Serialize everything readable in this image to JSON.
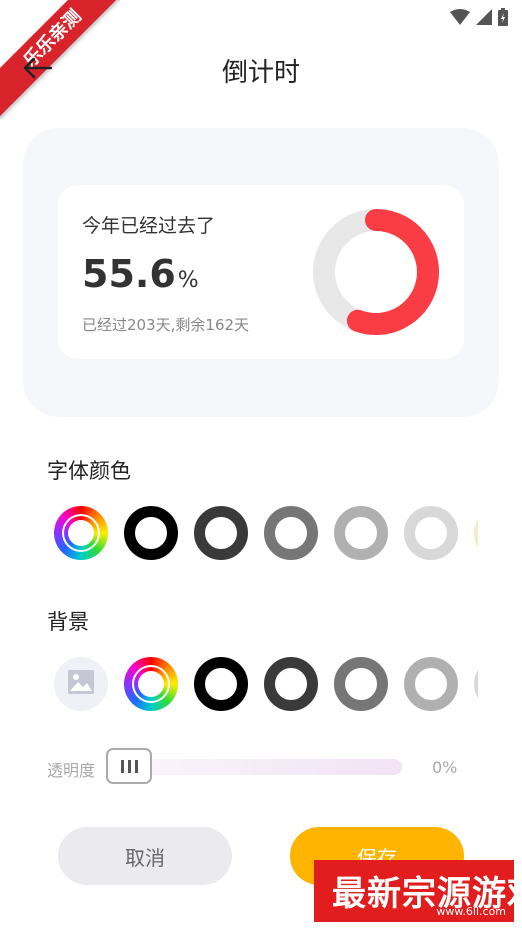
{
  "watermark_corner": "乐乐亲测",
  "header": {
    "title": "倒计时"
  },
  "widget": {
    "heading": "今年已经过去了",
    "percent_value": "55.6",
    "percent_unit": "%",
    "subtitle": "已经过203天,剩余162天",
    "progress_fraction": 0.556,
    "progress_color": "#fa3d45",
    "track_color": "#e8e8e8"
  },
  "font_color": {
    "label": "字体颜色",
    "swatches": [
      {
        "type": "rainbow",
        "icon": "color-wheel-icon"
      },
      {
        "type": "ring",
        "color": "#000000"
      },
      {
        "type": "ring",
        "color": "#3a3a3a"
      },
      {
        "type": "ring",
        "color": "#767676"
      },
      {
        "type": "ring",
        "color": "#b0b0b0"
      },
      {
        "type": "ring",
        "color": "#d8d8d8"
      },
      {
        "type": "ring",
        "color": "#f5ecc8"
      }
    ]
  },
  "background": {
    "label": "背景",
    "swatches": [
      {
        "type": "image",
        "icon": "image-icon"
      },
      {
        "type": "rainbow",
        "icon": "color-wheel-icon"
      },
      {
        "type": "ring",
        "color": "#000000"
      },
      {
        "type": "ring",
        "color": "#3a3a3a"
      },
      {
        "type": "ring",
        "color": "#767676"
      },
      {
        "type": "ring",
        "color": "#b0b0b0"
      },
      {
        "type": "ring",
        "color": "#d8d8d8"
      }
    ]
  },
  "opacity": {
    "label": "透明度",
    "value": "0%",
    "level": 0
  },
  "buttons": {
    "cancel": "取消",
    "save": "保存"
  },
  "watermark_site": {
    "main": "最新宗源游戏",
    "sub": "www.6ll.com"
  }
}
